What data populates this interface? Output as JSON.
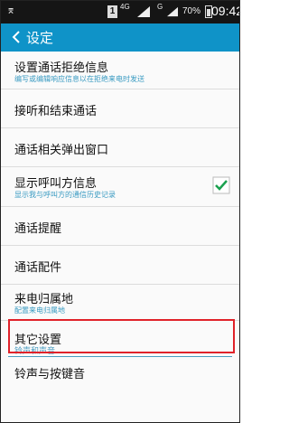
{
  "status_bar": {
    "network_type": "4G",
    "network_type_2": "G",
    "battery_percent": "70%",
    "time": "09:42",
    "sim_label": "1"
  },
  "app_bar": {
    "title": "设定",
    "back_icon": "chevron-left-icon"
  },
  "settings": [
    {
      "title": "设置通话拒绝信息",
      "subtitle": "编写或编辑响应信息以在拒绝来电时发送"
    },
    {
      "title": "接听和结束通话"
    },
    {
      "title": "通话相关弹出窗口"
    },
    {
      "title": "显示呼叫方信息",
      "subtitle": "显示我与呼叫方的通信历史记录",
      "checked": true
    },
    {
      "title": "通话提醒"
    },
    {
      "title": "通话配件"
    },
    {
      "title": "来电归属地",
      "subtitle": "配置来电归属地"
    },
    {
      "title": "其它设置"
    }
  ],
  "section_header": "铃声和声音",
  "bottom_item": {
    "title": "铃声与按键音"
  },
  "colors": {
    "app_bar": "#0f93c8",
    "accent_text": "#3a9bc2",
    "checkbox": "#1aa14f",
    "highlight_border": "#e0222a"
  }
}
